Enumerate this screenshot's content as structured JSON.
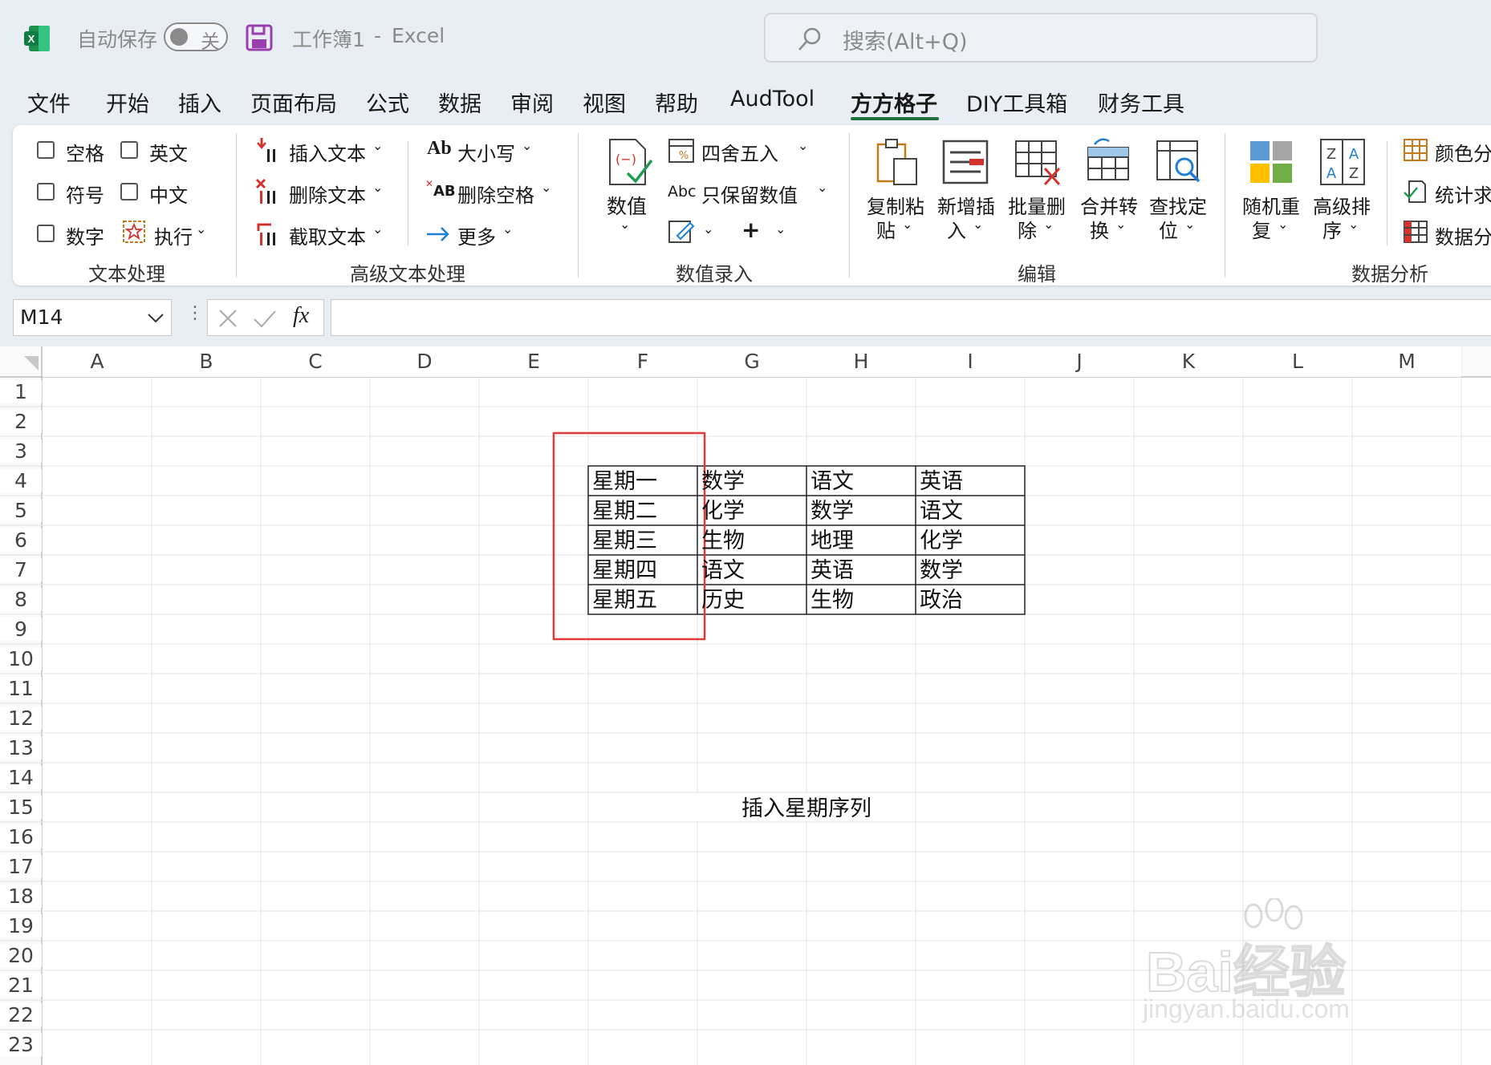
{
  "titlebar": {
    "autosave_label": "自动保存",
    "autosave_state": "关",
    "doc_title": "工作簿1",
    "separator": "-",
    "app_name": "Excel",
    "search_placeholder": "搜索(Alt+Q)"
  },
  "menu": {
    "items": [
      "文件",
      "开始",
      "插入",
      "页面布局",
      "公式",
      "数据",
      "审阅",
      "视图",
      "帮助",
      "AudTool",
      "方方格子",
      "DIY工具箱",
      "财务工具"
    ],
    "active": "方方格子"
  },
  "ribbon": {
    "text_processing": {
      "checkboxes": [
        "空格",
        "英文",
        "符号",
        "中文",
        "数字"
      ],
      "execute": "执行",
      "group_label": "文本处理"
    },
    "advanced_text": {
      "insert_text": "插入文本",
      "delete_text": "删除文本",
      "extract_text": "截取文本",
      "case": "大小写",
      "case_icon_text": "Ab",
      "delete_spaces": "删除空格",
      "delete_spaces_icon_text": "AB",
      "more": "更多",
      "group_label": "高级文本处理"
    },
    "numeric_entry": {
      "numeric": "数值",
      "round": "四舍五入",
      "keep_numbers": "只保留数值",
      "keep_numbers_icon_text": "Abc",
      "group_label": "数值录入"
    },
    "edit": {
      "copy_paste": [
        "复制粘",
        "贴"
      ],
      "insert_new": [
        "新增插",
        "入"
      ],
      "batch_delete": [
        "批量删",
        "除"
      ],
      "merge_convert": [
        "合并转",
        "换"
      ],
      "find_locate": [
        "查找定",
        "位"
      ],
      "group_label": "编辑"
    },
    "data_analysis": {
      "random_repeat": [
        "随机重",
        "复"
      ],
      "advanced_sort": [
        "高级排",
        "序"
      ],
      "color_sum": "颜色分",
      "stat": "统计求",
      "data_split": "数据分",
      "group_label": "数据分析"
    }
  },
  "formula_bar": {
    "name_box": "M14",
    "fx": "fx",
    "value": ""
  },
  "sheet": {
    "columns": [
      "A",
      "B",
      "C",
      "D",
      "E",
      "F",
      "G",
      "H",
      "I",
      "J",
      "K",
      "L",
      "M"
    ],
    "rows": [
      "1",
      "2",
      "3",
      "4",
      "5",
      "6",
      "7",
      "8",
      "9",
      "10",
      "11",
      "12",
      "13",
      "14",
      "15",
      "16",
      "17",
      "18",
      "19",
      "20",
      "21",
      "22",
      "23"
    ],
    "table": [
      [
        "星期一",
        "数学",
        "语文",
        "英语"
      ],
      [
        "星期二",
        "化学",
        "数学",
        "语文"
      ],
      [
        "星期三",
        "生物",
        "地理",
        "化学"
      ],
      [
        "星期四",
        "语文",
        "英语",
        "数学"
      ],
      [
        "星期五",
        "历史",
        "生物",
        "政治"
      ]
    ],
    "caption": "插入星期序列",
    "highlight_color": "#e03a3a"
  },
  "watermark": {
    "text": "Bai经验",
    "sub": "jingyan.baidu.com"
  },
  "colors": {
    "accent": "#1e6f3d",
    "chrome": "#e9eef4"
  }
}
